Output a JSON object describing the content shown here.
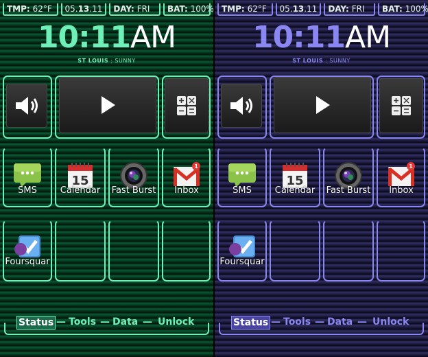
{
  "panels": [
    {
      "accent": "#6ff0b8",
      "highlight": "#1f6a4c",
      "status": {
        "tmp_label": "TMP:",
        "tmp_value": "62°F",
        "date_a": "05.",
        "date_b": "13",
        "date_c": ".11",
        "day_label": "DAY:",
        "day_value": "FRI",
        "bat_label": "BAT:",
        "bat_value": "100%"
      },
      "clock": {
        "hh": "10:11",
        "ampm": "AM"
      },
      "location": {
        "city": "ST LOUIS",
        "sep": ":",
        "weather": "SUNNY"
      },
      "apps": [
        "SMS",
        "Calendar",
        "Fast Burst",
        "Inbox",
        "Foursquar"
      ],
      "calendar_day": "15",
      "nav": {
        "status": "Status",
        "tools": "Tools",
        "data": "Data",
        "unlock": "Unlock",
        "dash": "—"
      }
    },
    {
      "accent": "#8a86f2",
      "highlight": "#4a46a0",
      "status": {
        "tmp_label": "TMP:",
        "tmp_value": "62°F",
        "date_a": "05.",
        "date_b": "13",
        "date_c": ".11",
        "day_label": "DAY:",
        "day_value": "FRI",
        "bat_label": "BAT:",
        "bat_value": "100%"
      },
      "clock": {
        "hh": "10:11",
        "ampm": "AM"
      },
      "location": {
        "city": "ST LOUIS",
        "sep": ":",
        "weather": "SUNNY"
      },
      "apps": [
        "SMS",
        "Calendar",
        "Fast Burst",
        "Inbox",
        "Foursquar"
      ],
      "calendar_day": "15",
      "nav": {
        "status": "Status",
        "tools": "Tools",
        "data": "Data",
        "unlock": "Unlock",
        "dash": "—"
      }
    }
  ],
  "icons": {
    "volume": "speaker-icon",
    "play": "play-icon",
    "calculator": "calculator-icon",
    "sms": "sms-icon",
    "calendar": "calendar-icon",
    "camera": "camera-icon",
    "gmail": "gmail-icon",
    "foursquare": "foursquare-icon"
  },
  "inbox_badge": "1"
}
